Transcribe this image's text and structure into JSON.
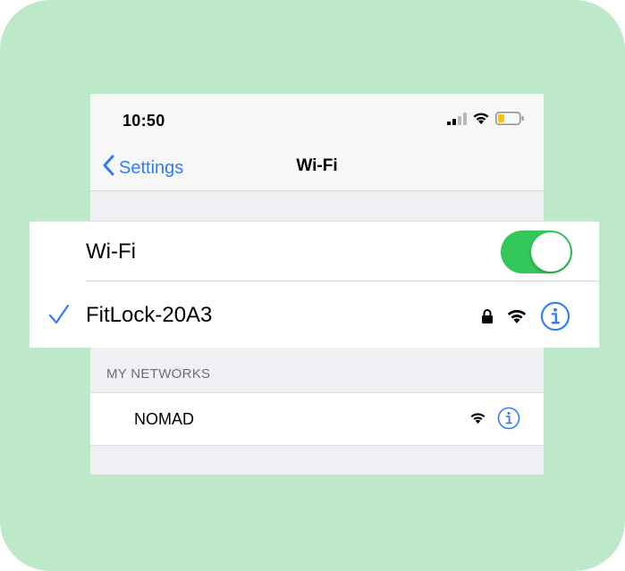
{
  "status_bar": {
    "time": "10:50",
    "icons": [
      "cellular-signal-icon",
      "wifi-icon",
      "battery-low-icon"
    ]
  },
  "nav": {
    "back_label": "Settings",
    "title": "Wi-Fi"
  },
  "wifi_toggle": {
    "label": "Wi-Fi",
    "on": true,
    "color": "#34c759"
  },
  "connected_network": {
    "name": "FitLock-20A3",
    "secured": true,
    "icons": [
      "checkmark-icon",
      "lock-icon",
      "wifi-icon",
      "info-icon"
    ]
  },
  "my_networks": {
    "header": "MY NETWORKS",
    "items": [
      {
        "name": "NOMAD",
        "icons": [
          "wifi-icon",
          "info-icon"
        ]
      }
    ]
  },
  "colors": {
    "accent": "#2f7cf6",
    "background": "#bde9c9",
    "toggle_on": "#34c759"
  }
}
